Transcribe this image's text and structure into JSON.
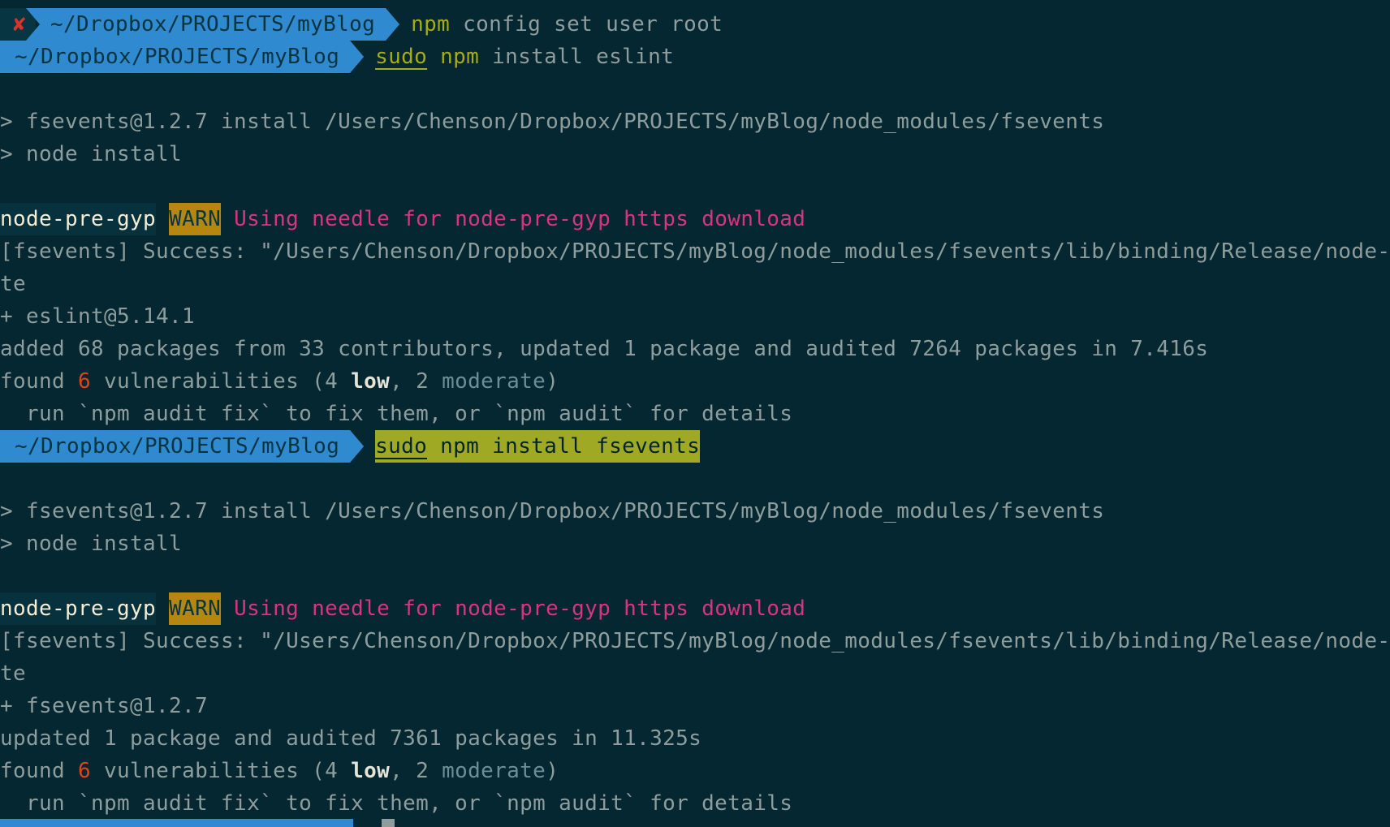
{
  "colors": {
    "background": "#042731",
    "prompt_blue": "#2f8ad0",
    "command": "#a5ad13",
    "warn_bg": "#b58610",
    "warn_text": "#d6357f",
    "error_x": "#e0302c"
  },
  "lines": [
    [
      {
        "t": "✘",
        "c": "xseg",
        "n": "error-status-icon"
      },
      {
        "t": "~/Dropbox/PROJECTS/myBlog",
        "c": "blue notch",
        "n": "prompt-path"
      },
      {
        "t": "npm",
        "c": "cmd"
      },
      {
        "t": " config set user root",
        "c": "plain"
      }
    ],
    [
      {
        "t": "~/Dropbox/PROJECTS/myBlog",
        "c": "blue",
        "n": "prompt-path"
      },
      {
        "t": "sudo",
        "c": "ul"
      },
      {
        "t": " ",
        "c": "plain"
      },
      {
        "t": "npm",
        "c": "cmd"
      },
      {
        "t": " install eslint",
        "c": "plain"
      }
    ],
    [],
    [
      {
        "t": "> fsevents@1.2.7 install /Users/Chenson/Dropbox/PROJECTS/myBlog/node_modules/fsevents",
        "c": "plain"
      }
    ],
    [
      {
        "t": "> node install",
        "c": "plain"
      }
    ],
    [],
    [
      {
        "t": "node-pre-gyp",
        "c": "hl"
      },
      {
        "t": " ",
        "c": "plain"
      },
      {
        "t": "WARN",
        "c": "warn",
        "n": "warn-badge"
      },
      {
        "t": " Using needle for node-pre-gyp https download",
        "c": "mag"
      }
    ],
    [
      {
        "t": "[fsevents] Success: \"/Users/Chenson/Dropbox/PROJECTS/myBlog/node_modules/fsevents/lib/binding/Release/node-",
        "c": "plain"
      }
    ],
    [
      {
        "t": "te",
        "c": "plain"
      }
    ],
    [
      {
        "t": "+ eslint@5.14.1",
        "c": "plain"
      }
    ],
    [
      {
        "t": "added 68 packages from 33 contributors, updated 1 package and audited 7264 packages in 7.416s",
        "c": "plain"
      }
    ],
    [
      {
        "t": "found ",
        "c": "plain"
      },
      {
        "t": "6",
        "c": "org"
      },
      {
        "t": " vulnerabilities (4 ",
        "c": "plain"
      },
      {
        "t": "low",
        "c": "bold"
      },
      {
        "t": ", 2 ",
        "c": "plain"
      },
      {
        "t": "moderate",
        "c": "mod"
      },
      {
        "t": ")",
        "c": "plain"
      }
    ],
    [
      {
        "t": "  run `npm audit fix` to fix them, or `npm audit` for details",
        "c": "plain"
      }
    ],
    [
      {
        "t": "~/Dropbox/PROJECTS/myBlog",
        "c": "blue",
        "n": "prompt-path"
      },
      {
        "t": "sudo",
        "c": "hicmd-ul"
      },
      {
        "t": " npm install fsevents",
        "c": "hicmd"
      }
    ],
    [],
    [
      {
        "t": "> fsevents@1.2.7 install /Users/Chenson/Dropbox/PROJECTS/myBlog/node_modules/fsevents",
        "c": "plain"
      }
    ],
    [
      {
        "t": "> node install",
        "c": "plain"
      }
    ],
    [],
    [
      {
        "t": "node-pre-gyp",
        "c": "hl"
      },
      {
        "t": " ",
        "c": "plain"
      },
      {
        "t": "WARN",
        "c": "warn",
        "n": "warn-badge"
      },
      {
        "t": " Using needle for node-pre-gyp https download",
        "c": "mag"
      }
    ],
    [
      {
        "t": "[fsevents] Success: \"/Users/Chenson/Dropbox/PROJECTS/myBlog/node_modules/fsevents/lib/binding/Release/node-",
        "c": "plain"
      }
    ],
    [
      {
        "t": "te",
        "c": "plain"
      }
    ],
    [
      {
        "t": "+ fsevents@1.2.7",
        "c": "plain"
      }
    ],
    [
      {
        "t": "updated 1 package and audited 7361 packages in 11.325s",
        "c": "plain"
      }
    ],
    [
      {
        "t": "found ",
        "c": "plain"
      },
      {
        "t": "6",
        "c": "org"
      },
      {
        "t": " vulnerabilities (4 ",
        "c": "plain"
      },
      {
        "t": "low",
        "c": "bold"
      },
      {
        "t": ", 2 ",
        "c": "plain"
      },
      {
        "t": "moderate",
        "c": "mod"
      },
      {
        "t": ")",
        "c": "plain"
      }
    ],
    [
      {
        "t": "  run `npm audit fix` to fix them, or `npm audit` for details",
        "c": "plain"
      }
    ]
  ]
}
